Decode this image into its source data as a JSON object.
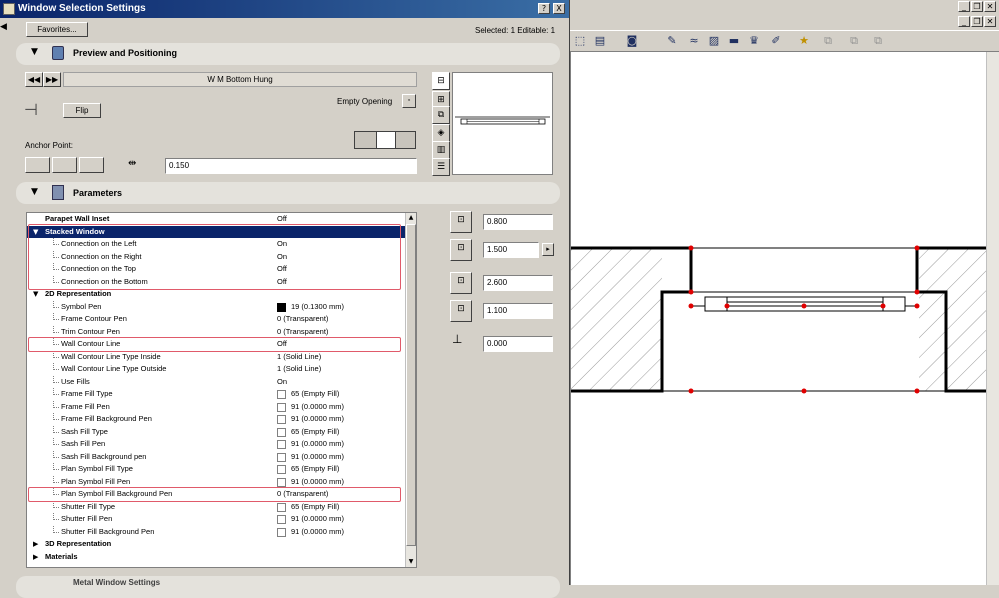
{
  "dialog": {
    "title": "Window Selection Settings",
    "help_btn": "?",
    "close_btn": "X",
    "favorites_label": "Favorites...",
    "selection_info": "Selected: 1 Editable: 1"
  },
  "preview": {
    "section_title": "Preview and Positioning",
    "object_name": "W M Bottom Hung",
    "flip_label": "Flip",
    "empty_opening_label": "Empty Opening",
    "anchor_label": "Anchor Point:",
    "offset_value": "0.150"
  },
  "parameters": {
    "section_title": "Parameters",
    "rows": [
      {
        "name": "Parapet Wall Inset",
        "value": "Off",
        "level": 0,
        "type": "plain"
      },
      {
        "name": "Stacked Window",
        "value": "",
        "level": 0,
        "type": "group-open",
        "selected": true
      },
      {
        "name": "Connection on the Left",
        "value": "On",
        "level": 1,
        "type": "plain"
      },
      {
        "name": "Connection on the Right",
        "value": "On",
        "level": 1,
        "type": "plain"
      },
      {
        "name": "Connection on the Top",
        "value": "Off",
        "level": 1,
        "type": "plain"
      },
      {
        "name": "Connection on the Bottom",
        "value": "Off",
        "level": 1,
        "type": "plain"
      },
      {
        "name": "2D Representation",
        "value": "",
        "level": 0,
        "type": "group-open"
      },
      {
        "name": "Symbol Pen",
        "value": "19 (0.1300 mm)",
        "level": 1,
        "type": "swatch-black"
      },
      {
        "name": "Frame Contour Pen",
        "value": "0 (Transparent)",
        "level": 1,
        "type": "plain"
      },
      {
        "name": "Trim Contour Pen",
        "value": "0 (Transparent)",
        "level": 1,
        "type": "plain"
      },
      {
        "name": "Wall Contour Line",
        "value": "Off",
        "level": 1,
        "type": "plain"
      },
      {
        "name": "Wall Contour Line Type Inside",
        "value": "1 (Solid Line)",
        "level": 1,
        "type": "plain"
      },
      {
        "name": "Wall Contour Line Type Outside",
        "value": "1 (Solid Line)",
        "level": 1,
        "type": "plain"
      },
      {
        "name": "Use Fills",
        "value": "On",
        "level": 1,
        "type": "plain"
      },
      {
        "name": "Frame Fill Type",
        "value": "65 (Empty Fill)",
        "level": 1,
        "type": "swatch"
      },
      {
        "name": "Frame Fill Pen",
        "value": "91 (0.0000 mm)",
        "level": 1,
        "type": "swatch"
      },
      {
        "name": "Frame Fill Background Pen",
        "value": "91 (0.0000 mm)",
        "level": 1,
        "type": "swatch"
      },
      {
        "name": "Sash Fill Type",
        "value": "65 (Empty Fill)",
        "level": 1,
        "type": "swatch"
      },
      {
        "name": "Sash Fill Pen",
        "value": "91 (0.0000 mm)",
        "level": 1,
        "type": "swatch"
      },
      {
        "name": "Sash Fill Background pen",
        "value": "91 (0.0000 mm)",
        "level": 1,
        "type": "swatch"
      },
      {
        "name": "Plan Symbol Fill Type",
        "value": "65 (Empty Fill)",
        "level": 1,
        "type": "swatch"
      },
      {
        "name": "Plan Symbol Fill Pen",
        "value": "91 (0.0000 mm)",
        "level": 1,
        "type": "swatch"
      },
      {
        "name": "Plan Symbol Fill Background Pen",
        "value": "0 (Transparent)",
        "level": 1,
        "type": "plain"
      },
      {
        "name": "Shutter Fill Type",
        "value": "65 (Empty Fill)",
        "level": 1,
        "type": "swatch"
      },
      {
        "name": "Shutter Fill Pen",
        "value": "91 (0.0000 mm)",
        "level": 1,
        "type": "swatch"
      },
      {
        "name": "Shutter Fill Background Pen",
        "value": "91 (0.0000 mm)",
        "level": 1,
        "type": "swatch"
      },
      {
        "name": "3D Representation",
        "value": "",
        "level": 0,
        "type": "group-closed"
      },
      {
        "name": "Materials",
        "value": "",
        "level": 0,
        "type": "group-closed"
      }
    ],
    "dims": [
      "0.800",
      "1.500",
      "2.600",
      "1.100",
      "0.000"
    ]
  },
  "bottom_section": "Metal Window Settings",
  "colors": {
    "title_start": "#0a246a",
    "title_end": "#3a6ea5",
    "highlight": "#e05a6a",
    "selection": "#0a246a"
  }
}
